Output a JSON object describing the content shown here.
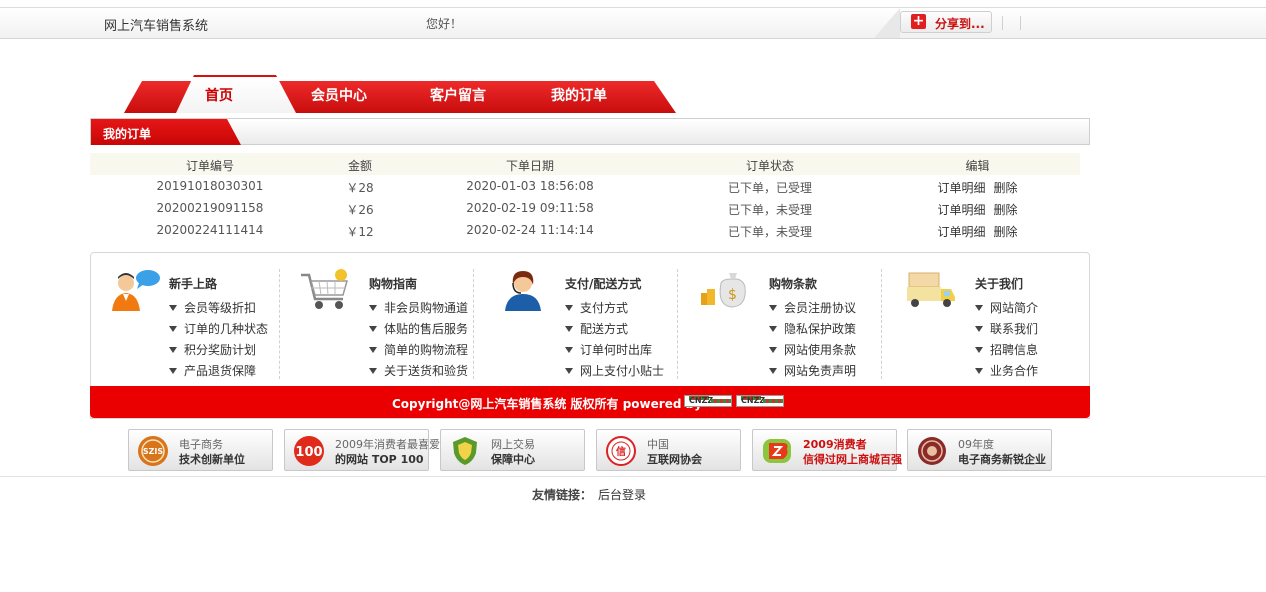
{
  "topbar": {
    "site_name": "网上汽车销售系统",
    "greeting": "您好！",
    "share_label": "分享到..."
  },
  "nav": {
    "tabs": [
      {
        "label": "首页",
        "active": true
      },
      {
        "label": "会员中心",
        "active": false
      },
      {
        "label": "客户留言",
        "active": false
      },
      {
        "label": "我的订单",
        "active": false
      }
    ]
  },
  "section": {
    "title": "我的订单"
  },
  "orders": {
    "headers": [
      "订单编号",
      "金额",
      "下单日期",
      "订单状态",
      "编辑"
    ],
    "rows": [
      {
        "id": "20191018030301",
        "amount": "￥28",
        "date": "2020-01-03 18:56:08",
        "status": "已下单，已受理"
      },
      {
        "id": "20200219091158",
        "amount": "￥26",
        "date": "2020-02-19 09:11:58",
        "status": "已下单，未受理"
      },
      {
        "id": "20200224111414",
        "amount": "￥12",
        "date": "2020-02-24 11:14:14",
        "status": "已下单，未受理"
      }
    ],
    "detail_label": "订单明细",
    "delete_label": "删除"
  },
  "help": {
    "columns": [
      {
        "title": "新手上路",
        "icon": "person-chat-icon",
        "items": [
          "会员等级折扣",
          "订单的几种状态",
          "积分奖励计划",
          "产品退货保障"
        ]
      },
      {
        "title": "购物指南",
        "icon": "shopping-cart-icon",
        "items": [
          "非会员购物通道",
          "体贴的售后服务",
          "简单的购物流程",
          "关于送货和验货"
        ]
      },
      {
        "title": "支付/配送方式",
        "icon": "customer-service-icon",
        "items": [
          "支付方式",
          "配送方式",
          "订单何时出库",
          "网上支付小贴士"
        ]
      },
      {
        "title": "购物条款",
        "icon": "money-bag-icon",
        "items": [
          "会员注册协议",
          "隐私保护政策",
          "网站使用条款",
          "网站免责声明"
        ]
      },
      {
        "title": "关于我们",
        "icon": "delivery-truck-icon",
        "items": [
          "网站简介",
          "联系我们",
          "招聘信息",
          "业务合作"
        ]
      }
    ]
  },
  "footer": {
    "copyright": "Copyright@网上汽车销售系统 版权所有 powered by",
    "cnzz": "CNZZ"
  },
  "badges": [
    {
      "line1": "电子商务",
      "line2": "技术创新单位",
      "seal": "SZIS"
    },
    {
      "line1": "2009年消费者最喜爱",
      "line2": "的网站 TOP 100",
      "seal": "100"
    },
    {
      "line1": "网上交易",
      "line2": "保障中心",
      "seal": ""
    },
    {
      "line1": "中国",
      "line2": "互联网协会",
      "seal": "信"
    },
    {
      "line1": "2009消费者",
      "line2": "信得过网上商城百强",
      "seal": ""
    },
    {
      "line1": "09年度",
      "line2": "电子商务新锐企业",
      "seal": ""
    }
  ],
  "friends": {
    "label": "友情链接：",
    "links": [
      "后台登录"
    ]
  },
  "colors": {
    "brand_red": "#e60000"
  }
}
